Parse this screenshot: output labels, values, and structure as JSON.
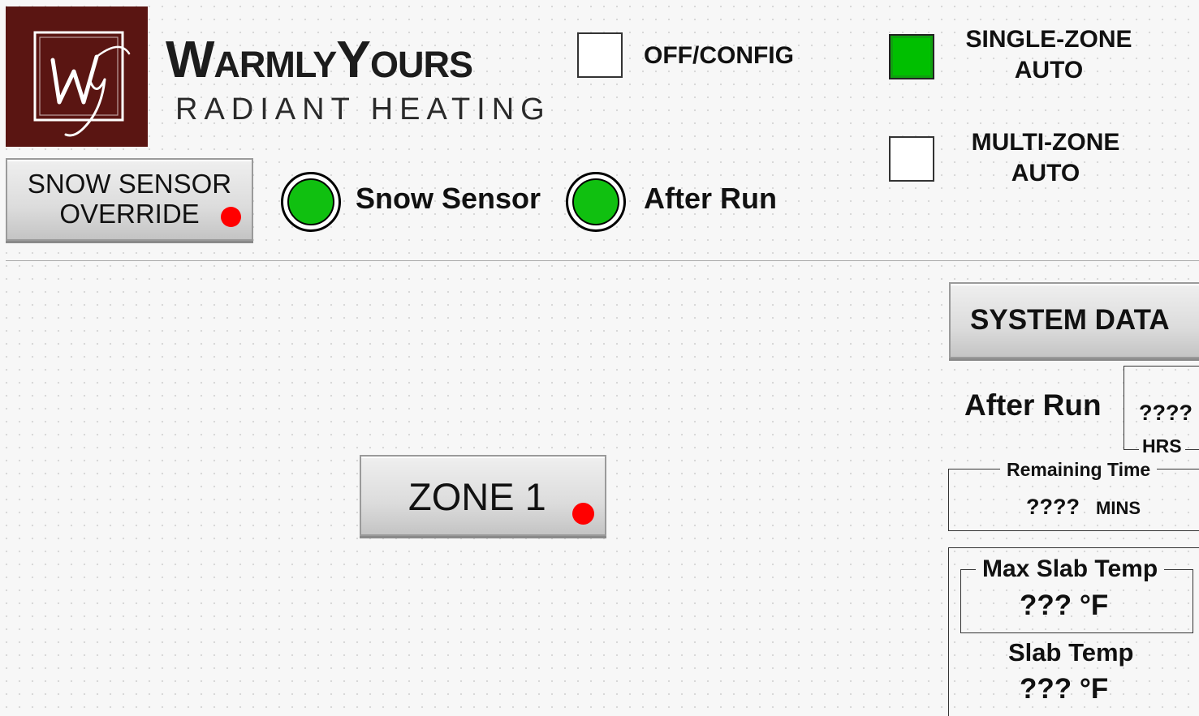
{
  "colors": {
    "logo_bg": "#5a1512",
    "active_green": "#00bf00",
    "indicator_green": "#10c010",
    "alarm_red": "#ff0000"
  },
  "header": {
    "logo": {
      "monogram": "Wy"
    },
    "brand_title": "WarmlyYours",
    "brand_subtitle": "RADIANT HEATING"
  },
  "modes": {
    "off_config": {
      "label": "OFF/CONFIG",
      "checked": false
    },
    "single_zone": {
      "label_line1": "SINGLE-ZONE",
      "label_line2": "AUTO",
      "checked": true
    },
    "multi_zone": {
      "label_line1": "MULTI-ZONE",
      "label_line2": "AUTO",
      "checked": false
    }
  },
  "snow_override": {
    "label_line1": "SNOW SENSOR",
    "label_line2": "OVERRIDE",
    "status": "red-dot"
  },
  "indicators": [
    {
      "label": "Snow Sensor",
      "state": "on",
      "icon": "indicator-lamp"
    },
    {
      "label": "After Run",
      "state": "on",
      "icon": "indicator-lamp"
    }
  ],
  "zone_button": {
    "label": "ZONE 1",
    "status": "red-dot"
  },
  "system_data": {
    "button_label": "SYSTEM DATA",
    "after_run": {
      "label": "After Run",
      "value": "????",
      "unit": "HRS"
    },
    "remaining_time": {
      "legend": "Remaining Time",
      "value": "????",
      "unit": "MINS"
    },
    "max_slab_temp": {
      "legend": "Max Slab Temp",
      "value": "??? °F"
    },
    "slab_temp": {
      "label": "Slab Temp",
      "value": "??? °F"
    }
  }
}
